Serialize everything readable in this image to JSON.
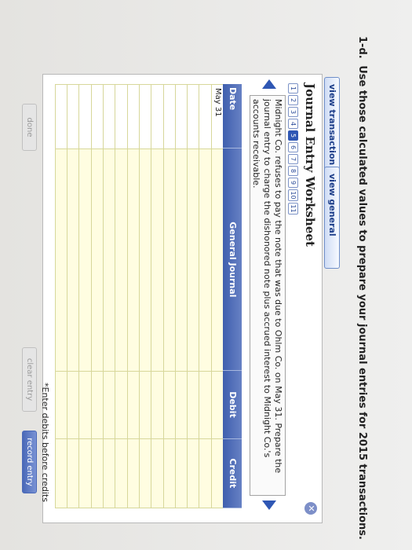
{
  "question": {
    "number": "1-d.",
    "text": "Use those calculated values to prepare your journal entries for 2015 transactions."
  },
  "tabs": {
    "transaction_list": "view transaction list",
    "general_journal": "view general journal"
  },
  "worksheet": {
    "title": "Journal Entry Worksheet",
    "steps": [
      "1",
      "2",
      "3",
      "4",
      "5",
      "6",
      "7",
      "8",
      "9",
      "10",
      "11"
    ],
    "active_step": "5",
    "description": "Midnight Co. refuses to pay the note that was due to Ohlm Co. on May 31. Prepare the journal entry to charge the dishonored note plus accrued interest to Midnight Co.'s accounts receivable."
  },
  "table": {
    "headers": {
      "date": "Date",
      "general_journal": "General Journal",
      "debit": "Debit",
      "credit": "Credit"
    },
    "date_value": "May 31"
  },
  "hint": "*Enter debits before credits",
  "buttons": {
    "done": "done",
    "clear": "clear entry",
    "record": "record entry"
  },
  "icons": {
    "close": "close-icon",
    "prev": "arrow-left-icon",
    "next": "arrow-right-icon"
  }
}
